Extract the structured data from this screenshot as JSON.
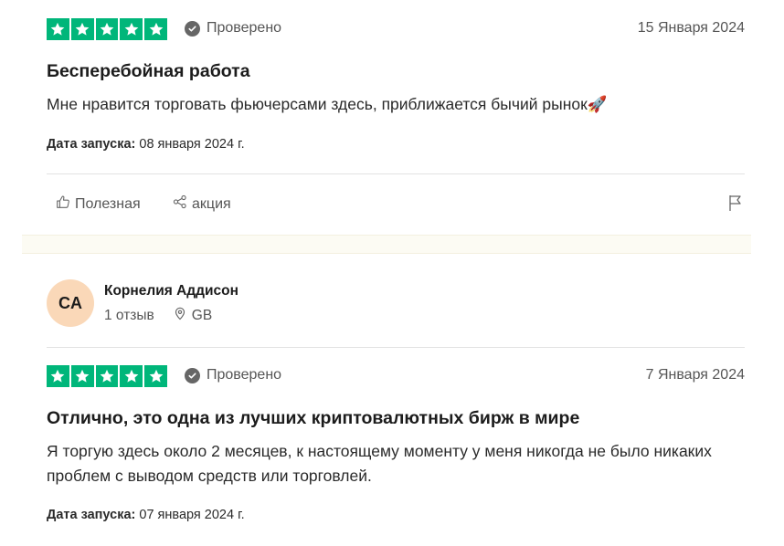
{
  "reviews": [
    {
      "rating": 5,
      "verified_label": "Проверено",
      "date": "15 Января 2024",
      "title": "Бесперебойная работа",
      "body": "Мне нравится торговать фьючерсами здесь, приближается бычий рынок🚀",
      "launch_label": "Дата запуска:",
      "launch_date": "08 января 2024 г.",
      "actions": {
        "useful_label": "Полезная",
        "share_label": "акция"
      }
    },
    {
      "author": {
        "initials": "CA",
        "name": "Корнелия Аддисон",
        "reviews_count": "1 отзыв",
        "country": "GB"
      },
      "rating": 5,
      "verified_label": "Проверено",
      "date": "7 Января 2024",
      "title": "Отлично, это одна из лучших криптовалютных бирж в мире",
      "body": "Я торгую здесь около 2 месяцев, к настоящему моменту у меня никогда не было никаких проблем с выводом средств или торговлей.",
      "launch_label": "Дата запуска:",
      "launch_date": "07 января 2024 г."
    }
  ],
  "colors": {
    "star_green": "#00b67a",
    "avatar_bg": "#fad8b8",
    "band_bg": "#fcfbf3"
  },
  "icons": [
    "star-icon",
    "check-circle-icon",
    "thumbs-up-icon",
    "share-icon",
    "flag-icon",
    "location-pin-icon"
  ]
}
